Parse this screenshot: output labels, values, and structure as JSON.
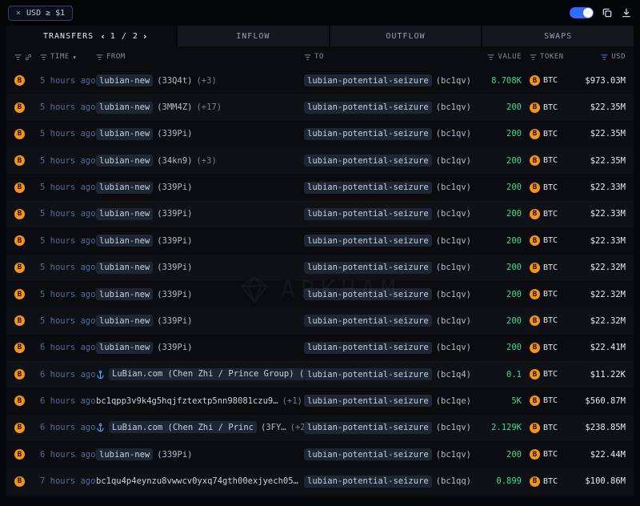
{
  "topbar": {
    "filter_close": "×",
    "filter_label": "USD ≥ $1"
  },
  "tabs": {
    "transfers": "TRANSFERS",
    "page_prev": "‹",
    "pagination": "1 / 2",
    "page_next": "›",
    "inflow": "INFLOW",
    "outflow": "OUTFLOW",
    "swaps": "SWAPS"
  },
  "watermark": "ARKHAM",
  "colors": {
    "value_green": "#3ddc8e",
    "btc_orange": "#f7931a",
    "toggle_blue": "#2f6bff",
    "filter_active_blue": "#4d7cff"
  },
  "table": {
    "headers": {
      "time": "TIME",
      "from": "FROM",
      "to": "TO",
      "value": "VALUE",
      "token": "TOKEN",
      "usd": "USD"
    },
    "rows": [
      {
        "time": "5 hours ago",
        "from": {
          "icon": false,
          "chip": true,
          "label": "lubian-new",
          "suffix": "(33Q4t)",
          "extra": "(+3)"
        },
        "to": {
          "label": "lubian-potential-seizure",
          "suffix": "(bc1qv)"
        },
        "value": "8.708K",
        "token": "BTC",
        "usd": "$973.03M"
      },
      {
        "time": "5 hours ago",
        "from": {
          "icon": false,
          "chip": true,
          "label": "lubian-new",
          "suffix": "(3MM4Z)",
          "extra": "(+17)"
        },
        "to": {
          "label": "lubian-potential-seizure",
          "suffix": "(bc1qv)"
        },
        "value": "200",
        "token": "BTC",
        "usd": "$22.35M"
      },
      {
        "time": "5 hours ago",
        "from": {
          "icon": false,
          "chip": true,
          "label": "lubian-new",
          "suffix": "(339Pi)",
          "extra": ""
        },
        "to": {
          "label": "lubian-potential-seizure",
          "suffix": "(bc1qv)"
        },
        "value": "200",
        "token": "BTC",
        "usd": "$22.35M"
      },
      {
        "time": "5 hours ago",
        "from": {
          "icon": false,
          "chip": true,
          "label": "lubian-new",
          "suffix": "(34kn9)",
          "extra": "(+3)"
        },
        "to": {
          "label": "lubian-potential-seizure",
          "suffix": "(bc1qv)"
        },
        "value": "200",
        "token": "BTC",
        "usd": "$22.35M"
      },
      {
        "time": "5 hours ago",
        "from": {
          "icon": false,
          "chip": true,
          "label": "lubian-new",
          "suffix": "(339Pi)",
          "extra": ""
        },
        "to": {
          "label": "lubian-potential-seizure",
          "suffix": "(bc1qv)"
        },
        "value": "200",
        "token": "BTC",
        "usd": "$22.33M"
      },
      {
        "time": "5 hours ago",
        "from": {
          "icon": false,
          "chip": true,
          "label": "lubian-new",
          "suffix": "(339Pi)",
          "extra": ""
        },
        "to": {
          "label": "lubian-potential-seizure",
          "suffix": "(bc1qv)"
        },
        "value": "200",
        "token": "BTC",
        "usd": "$22.33M"
      },
      {
        "time": "5 hours ago",
        "from": {
          "icon": false,
          "chip": true,
          "label": "lubian-new",
          "suffix": "(339Pi)",
          "extra": ""
        },
        "to": {
          "label": "lubian-potential-seizure",
          "suffix": "(bc1qv)"
        },
        "value": "200",
        "token": "BTC",
        "usd": "$22.33M"
      },
      {
        "time": "5 hours ago",
        "from": {
          "icon": false,
          "chip": true,
          "label": "lubian-new",
          "suffix": "(339Pi)",
          "extra": ""
        },
        "to": {
          "label": "lubian-potential-seizure",
          "suffix": "(bc1qv)"
        },
        "value": "200",
        "token": "BTC",
        "usd": "$22.32M"
      },
      {
        "time": "5 hours ago",
        "from": {
          "icon": false,
          "chip": true,
          "label": "lubian-new",
          "suffix": "(339Pi)",
          "extra": ""
        },
        "to": {
          "label": "lubian-potential-seizure",
          "suffix": "(bc1qv)"
        },
        "value": "200",
        "token": "BTC",
        "usd": "$22.32M"
      },
      {
        "time": "5 hours ago",
        "from": {
          "icon": false,
          "chip": true,
          "label": "lubian-new",
          "suffix": "(339Pi)",
          "extra": ""
        },
        "to": {
          "label": "lubian-potential-seizure",
          "suffix": "(bc1qv)"
        },
        "value": "200",
        "token": "BTC",
        "usd": "$22.32M"
      },
      {
        "time": "6 hours ago",
        "from": {
          "icon": false,
          "chip": true,
          "label": "lubian-new",
          "suffix": "(339Pi)",
          "extra": ""
        },
        "to": {
          "label": "lubian-potential-seizure",
          "suffix": "(bc1qv)"
        },
        "value": "200",
        "token": "BTC",
        "usd": "$22.41M"
      },
      {
        "time": "6 hours ago",
        "from": {
          "icon": true,
          "chip": true,
          "label": "LuBian.com (Chen Zhi / Prince Group) (",
          "suffix": "",
          "extra": ""
        },
        "to": {
          "label": "lubian-potential-seizure",
          "suffix": "(bc1q4)"
        },
        "value": "0.1",
        "token": "BTC",
        "usd": "$11.22K"
      },
      {
        "time": "6 hours ago",
        "from": {
          "icon": false,
          "chip": false,
          "label": "bc1qpp3v9k4g5hqjfztextp5nn98081czu9…",
          "suffix": "",
          "extra": "(+1)"
        },
        "to": {
          "label": "lubian-potential-seizure",
          "suffix": "(bc1qe)"
        },
        "value": "5K",
        "token": "BTC",
        "usd": "$560.87M"
      },
      {
        "time": "6 hours ago",
        "from": {
          "icon": true,
          "chip": true,
          "label": "LuBian.com (Chen Zhi / Princ",
          "suffix": "(3FY…",
          "extra": "(+2)"
        },
        "to": {
          "label": "lubian-potential-seizure",
          "suffix": "(bc1qv)"
        },
        "value": "2.129K",
        "token": "BTC",
        "usd": "$238.85M"
      },
      {
        "time": "6 hours ago",
        "from": {
          "icon": false,
          "chip": true,
          "label": "lubian-new",
          "suffix": "(339Pi)",
          "extra": ""
        },
        "to": {
          "label": "lubian-potential-seizure",
          "suffix": "(bc1qv)"
        },
        "value": "200",
        "token": "BTC",
        "usd": "$22.44M"
      },
      {
        "time": "7 hours ago",
        "from": {
          "icon": false,
          "chip": false,
          "label": "bc1qu4p4eynzu8vwwcv0yxq74gth00exjyech05…",
          "suffix": "",
          "extra": ""
        },
        "to": {
          "label": "lubian-potential-seizure",
          "suffix": "(bc1qq)"
        },
        "value": "0.899",
        "token": "BTC",
        "usd": "$100.86M"
      }
    ]
  }
}
